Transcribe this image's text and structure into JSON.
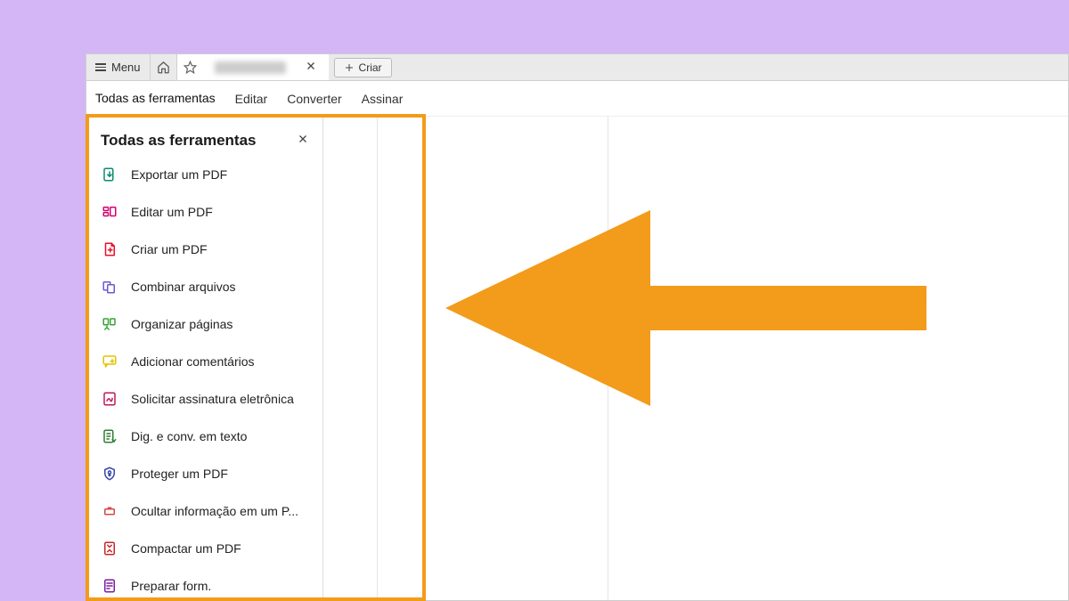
{
  "topbar": {
    "menu_label": "Menu",
    "create_label": "Criar"
  },
  "nav": {
    "tabs": [
      {
        "label": "Todas as ferramentas",
        "active": true
      },
      {
        "label": "Editar",
        "active": false
      },
      {
        "label": "Converter",
        "active": false
      },
      {
        "label": "Assinar",
        "active": false
      }
    ]
  },
  "tools_panel": {
    "title": "Todas as ferramentas",
    "items": [
      {
        "label": "Exportar um PDF",
        "icon": "export-pdf",
        "color": "#0d8a72"
      },
      {
        "label": "Editar um PDF",
        "icon": "edit-pdf",
        "color": "#d6006f"
      },
      {
        "label": "Criar um PDF",
        "icon": "create-pdf",
        "color": "#e8112d"
      },
      {
        "label": "Combinar arquivos",
        "icon": "combine",
        "color": "#6a5acd"
      },
      {
        "label": "Organizar páginas",
        "icon": "organize",
        "color": "#3aa335"
      },
      {
        "label": "Adicionar comentários",
        "icon": "comment",
        "color": "#e6c200"
      },
      {
        "label": "Solicitar assinatura eletrônica",
        "icon": "esign",
        "color": "#c2185b"
      },
      {
        "label": "Dig. e conv. em texto",
        "icon": "ocr",
        "color": "#2e7d32"
      },
      {
        "label": "Proteger um PDF",
        "icon": "protect",
        "color": "#3949ab"
      },
      {
        "label": "Ocultar informação em um P...",
        "icon": "redact",
        "color": "#d14b4b"
      },
      {
        "label": "Compactar um PDF",
        "icon": "compress",
        "color": "#c62828"
      },
      {
        "label": "Preparar form.",
        "icon": "form",
        "color": "#7b1fa2"
      }
    ]
  },
  "quickbar": {
    "buttons": [
      {
        "name": "pointer",
        "primary": true
      },
      {
        "name": "comment-bubble",
        "primary": false
      },
      {
        "name": "highlight-pen",
        "primary": false
      },
      {
        "name": "lasso",
        "primary": false
      },
      {
        "name": "text-select",
        "primary": false
      },
      {
        "name": "draw",
        "primary": false
      },
      {
        "name": "more",
        "primary": false
      }
    ]
  },
  "annotation": {
    "highlight_color": "#f39b1a",
    "arrow_color": "#f39b1a"
  }
}
